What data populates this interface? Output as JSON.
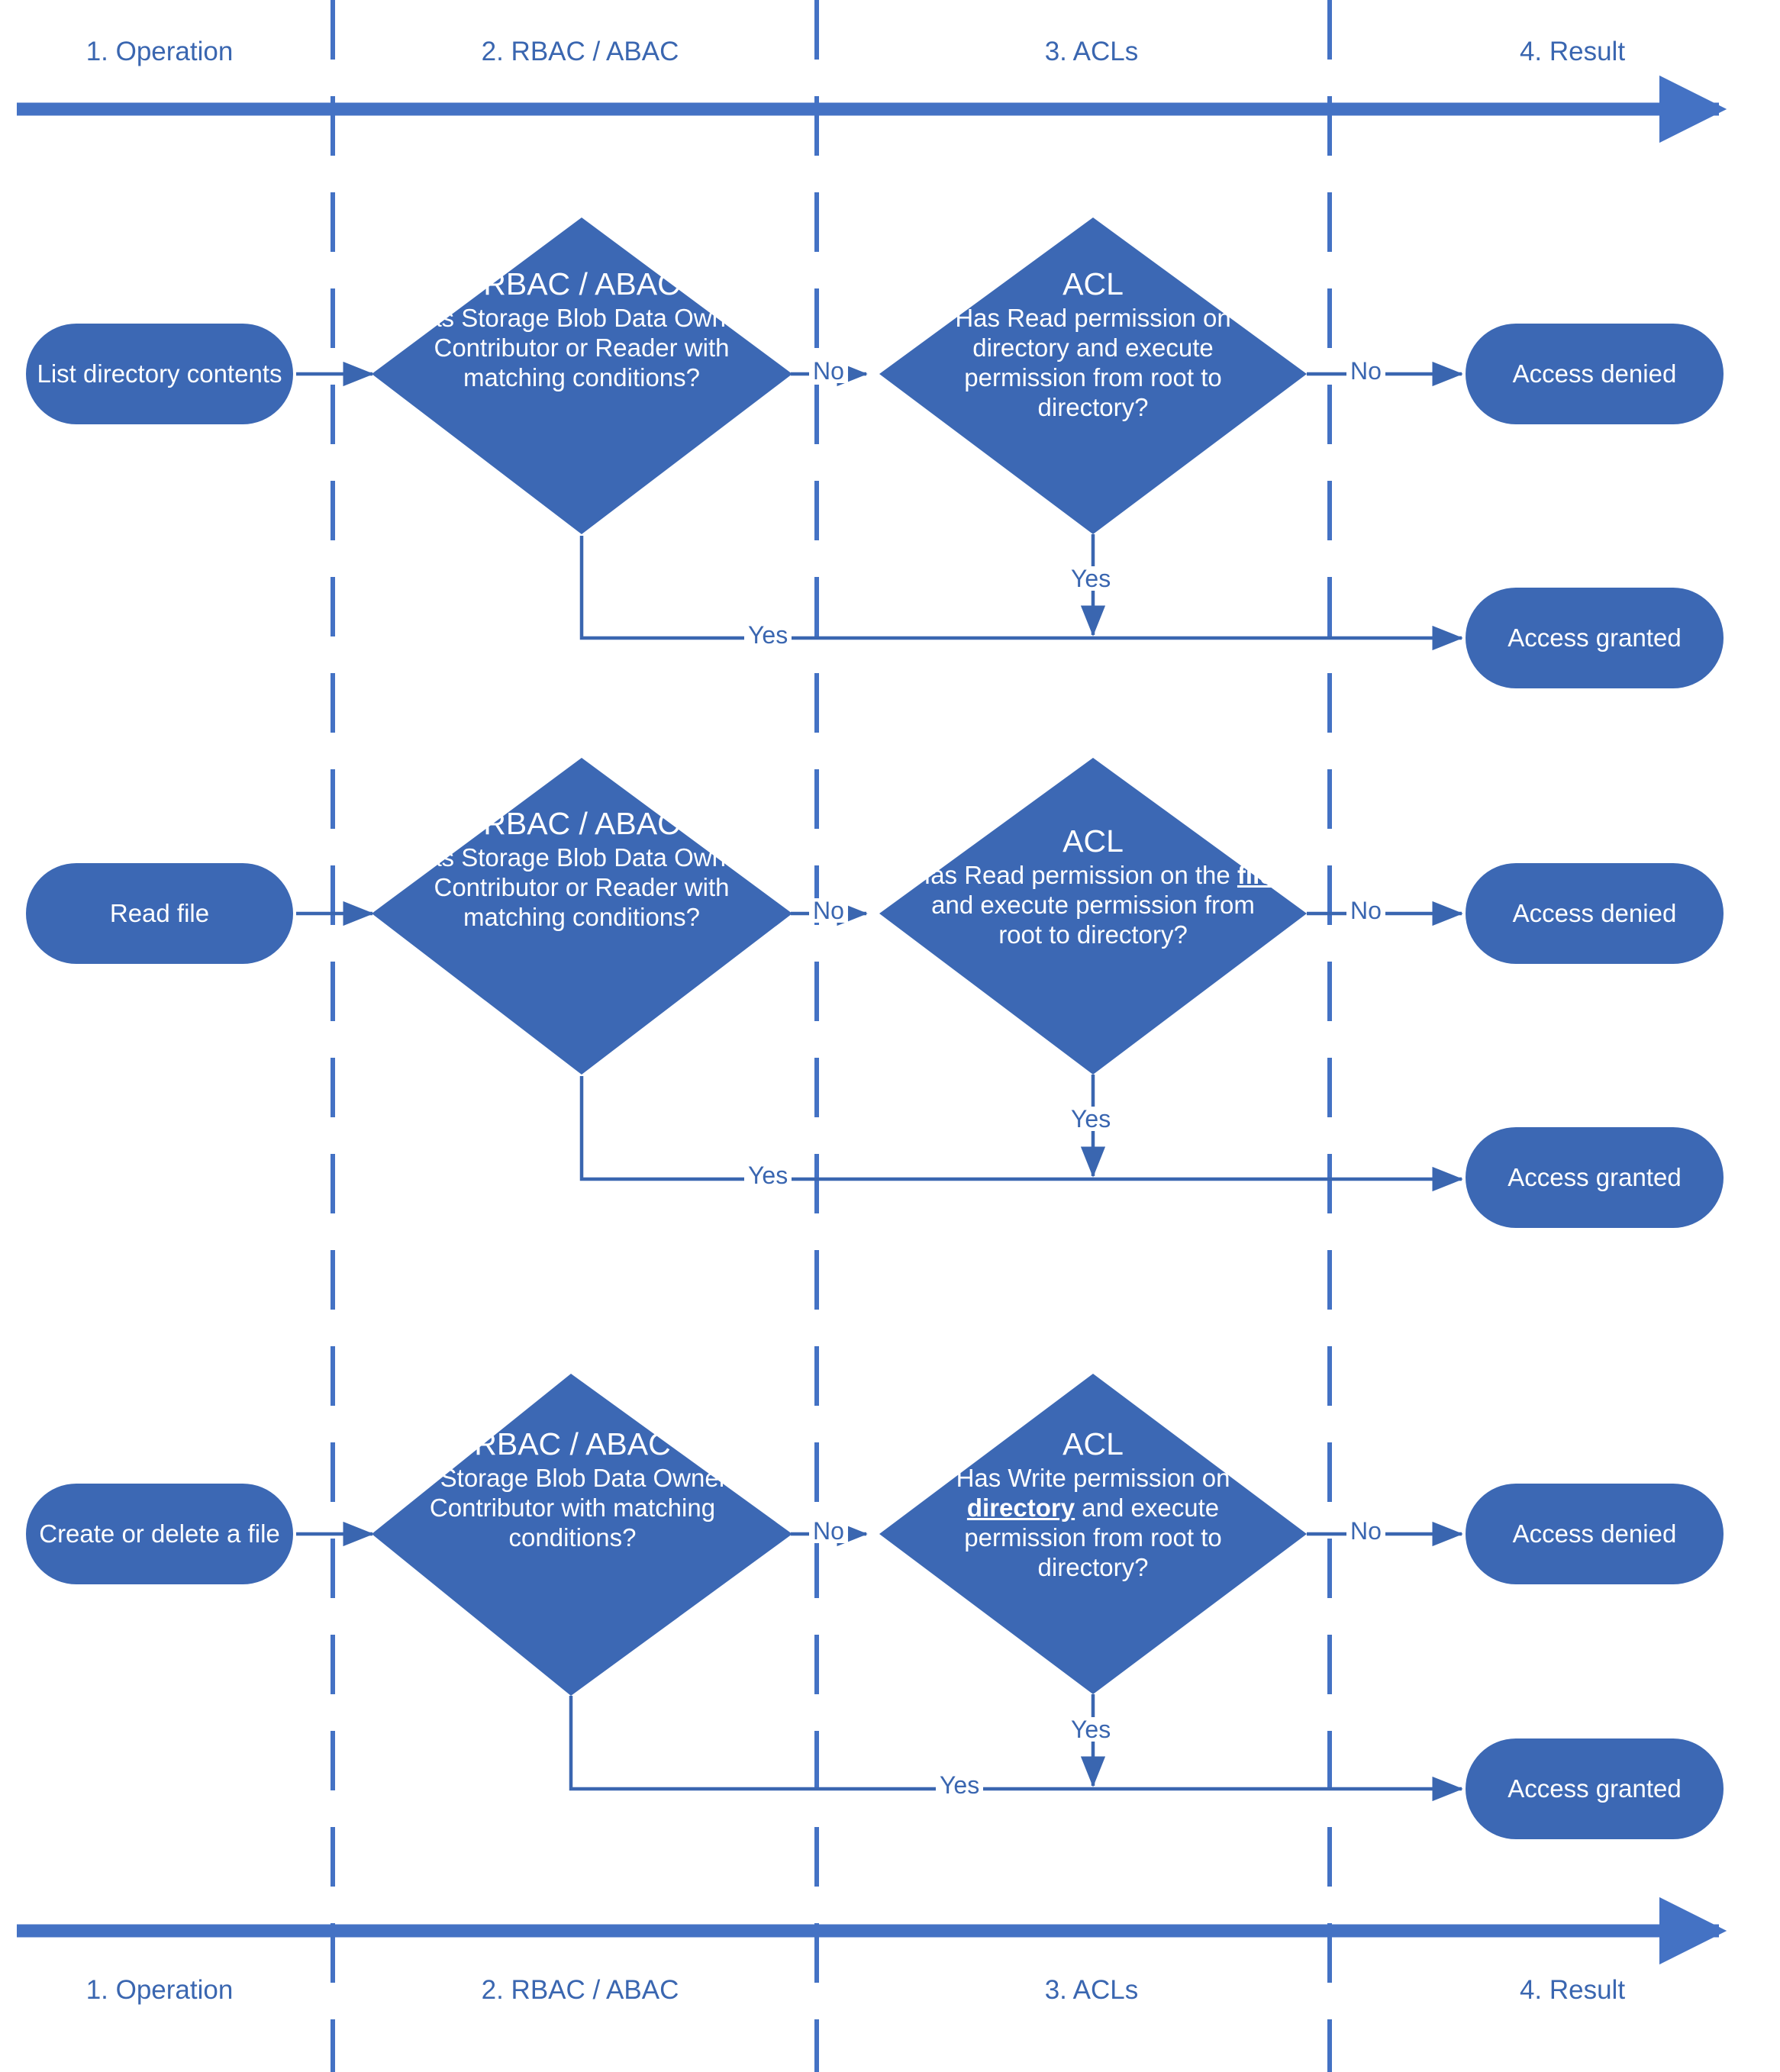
{
  "colors": {
    "node_fill": "#3C68B4",
    "line": "#3A66B0",
    "label_text": "#3A66B0",
    "node_text": "#FFFFFF",
    "background": "#FFFFFF"
  },
  "lanes": {
    "header": [
      {
        "label": "1. Operation"
      },
      {
        "label": "2. RBAC / ABAC"
      },
      {
        "label": "3. ACLs"
      },
      {
        "label": "4. Result"
      }
    ],
    "footer": [
      {
        "label": "1. Operation"
      },
      {
        "label": "2. RBAC / ABAC"
      },
      {
        "label": "3. ACLs"
      },
      {
        "label": "4. Result"
      }
    ]
  },
  "rows": [
    {
      "id": "list-directory-contents",
      "operation": {
        "label": "List directory contents"
      },
      "rbac": {
        "title": "RBAC / ABAC",
        "body_html": "Has Storage Blob Data Owner, Contributor or Reader with matching conditions?"
      },
      "acl": {
        "title": "ACL",
        "body_html": "Has Read permission on directory and execute permission from root to directory?"
      },
      "result_denied": {
        "label": "Access denied"
      },
      "result_granted": {
        "label": "Access granted"
      },
      "edges": {
        "rbac_no": "No",
        "rbac_yes": "Yes",
        "acl_no": "No",
        "acl_yes": "Yes"
      }
    },
    {
      "id": "read-file",
      "operation": {
        "label": "Read file"
      },
      "rbac": {
        "title": "RBAC / ABAC",
        "body_html": "Has Storage Blob Data Owner, Contributor or Reader with matching conditions?"
      },
      "acl": {
        "title": "ACL",
        "body_html": "Has Read permission on the <u>file</u> and execute permission from root to directory?"
      },
      "result_denied": {
        "label": "Access denied"
      },
      "result_granted": {
        "label": "Access granted"
      },
      "edges": {
        "rbac_no": "No",
        "rbac_yes": "Yes",
        "acl_no": "No",
        "acl_yes": "Yes"
      }
    },
    {
      "id": "create-or-delete-a-file",
      "operation": {
        "label": "Create or delete a file"
      },
      "rbac": {
        "title": "RBAC / ABAC",
        "body_html": "Has Storage Blob Data Owner or Contributor with matching conditions?"
      },
      "acl": {
        "title": "ACL",
        "body_html": "Has Write permission on <u>directory</u> and execute permission from root to directory?"
      },
      "result_denied": {
        "label": "Access denied"
      },
      "result_granted": {
        "label": "Access granted"
      },
      "edges": {
        "rbac_no": "No",
        "rbac_yes": "Yes",
        "acl_no": "No",
        "acl_yes": "Yes"
      }
    }
  ]
}
